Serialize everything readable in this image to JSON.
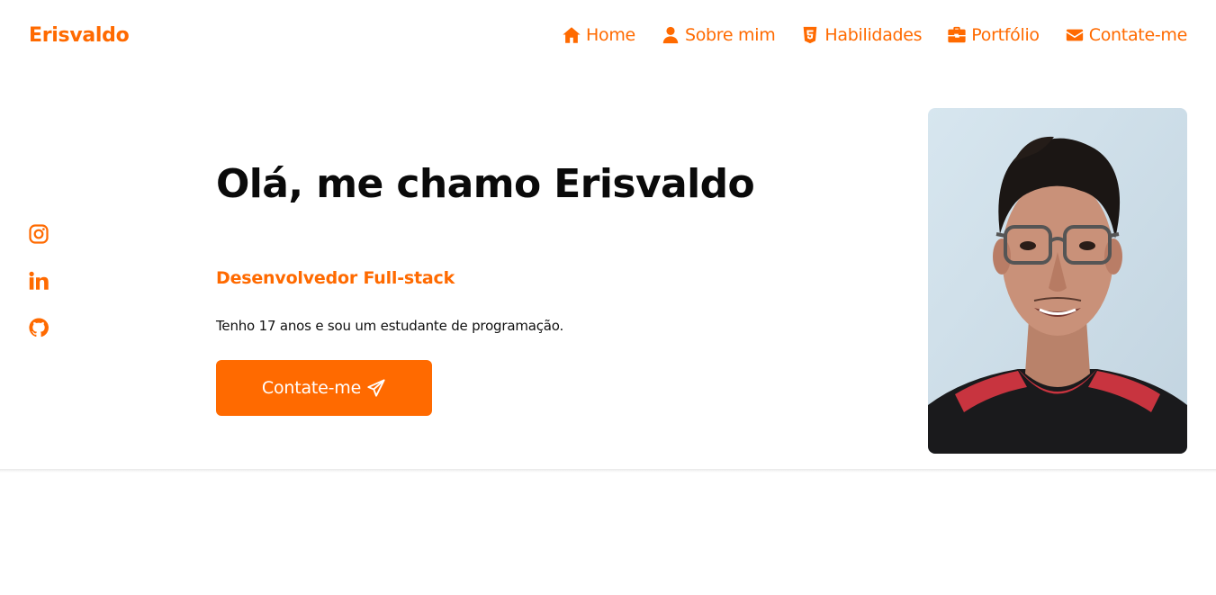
{
  "header": {
    "logo": "Erisvaldo",
    "nav": [
      {
        "label": "Home",
        "icon": "home-icon"
      },
      {
        "label": "Sobre mim",
        "icon": "user-icon"
      },
      {
        "label": "Habilidades",
        "icon": "html5-icon"
      },
      {
        "label": "Portfólio",
        "icon": "briefcase-icon"
      },
      {
        "label": "Contate-me",
        "icon": "envelope-icon"
      }
    ]
  },
  "socials": [
    {
      "name": "instagram",
      "icon": "instagram-icon"
    },
    {
      "name": "linkedin",
      "icon": "linkedin-icon"
    },
    {
      "name": "github",
      "icon": "github-icon"
    }
  ],
  "hero": {
    "title": "Olá, me chamo Erisvaldo",
    "subtitle": "Desenvolvedor Full-stack",
    "description": "Tenho 17 anos e sou um estudante de programação.",
    "cta_label": "Contate-me",
    "cta_icon": "paper-plane-icon"
  },
  "profile_photo": {
    "icon": "profile-photo"
  },
  "colors": {
    "accent": "#ff6a00",
    "text": "#0a0a0a",
    "background": "#ffffff"
  }
}
